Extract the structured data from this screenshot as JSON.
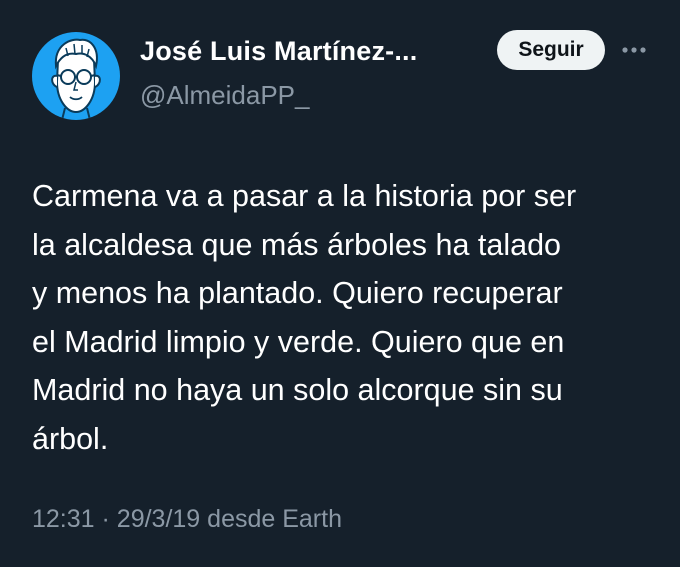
{
  "author": {
    "display_name": "José Luis Martínez-...",
    "handle": "@AlmeidaPP_",
    "avatar_icon": "cartoon-face-with-glasses-icon",
    "avatar_bg": "#1da1f2"
  },
  "actions": {
    "follow_label": "Seguir",
    "more_icon": "more-horizontal-icon"
  },
  "tweet": {
    "text": "Carmena va a pasar a la historia por ser\nla alcaldesa que más árboles ha talado\ny menos ha plantado. Quiero recuperar\nel Madrid limpio y verde. Quiero que en\nMadrid no haya un solo alcorque sin su\nárbol."
  },
  "meta": {
    "time": "12:31",
    "separator": "·",
    "date": "29/3/19",
    "source": "desde Earth"
  },
  "colors": {
    "background": "#15202b",
    "text": "#ffffff",
    "secondary": "#8b98a5",
    "button_bg": "#eff3f4"
  }
}
